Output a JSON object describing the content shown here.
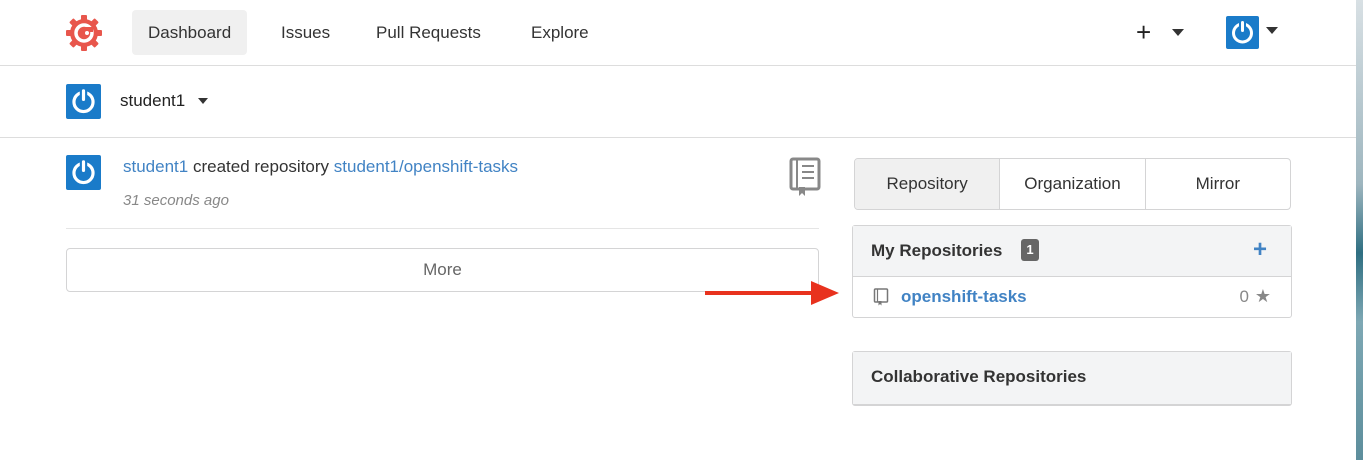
{
  "nav": {
    "items": [
      "Dashboard",
      "Issues",
      "Pull Requests",
      "Explore"
    ],
    "active": "Dashboard",
    "new_icon": "plus-icon",
    "logo_icon": "gogs-logo-icon"
  },
  "context": {
    "user": "student1"
  },
  "feed": {
    "entries": [
      {
        "actor": "student1",
        "action": "created repository",
        "repo": "student1/openshift-tasks",
        "time": "31 seconds ago",
        "icon": "book-icon"
      }
    ],
    "more_label": "More"
  },
  "tabs": [
    "Repository",
    "Organization",
    "Mirror"
  ],
  "my_repos": {
    "title": "My Repositories",
    "count": "1",
    "add_icon": "plus-icon",
    "items": [
      {
        "name": "openshift-tasks",
        "stars": "0",
        "icon": "repo-book-icon",
        "star_icon": "star-icon"
      }
    ]
  },
  "collab_repos": {
    "title": "Collaborative Repositories"
  },
  "colors": {
    "link": "#4183c4",
    "avatar": "#1a7bc9",
    "logo": "#e8564c",
    "arrow": "#e8321e"
  }
}
